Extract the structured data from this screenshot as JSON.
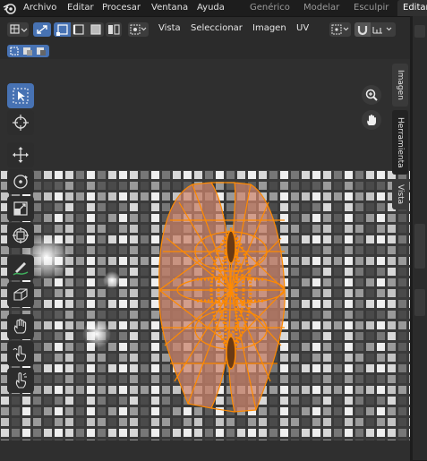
{
  "menu": [
    "Archivo",
    "Editar",
    "Procesar",
    "Ventana",
    "Ayuda"
  ],
  "workspaces": [
    "Genérico",
    "Modelar",
    "Esculpir",
    "Editar"
  ],
  "header_menu": [
    "Vista",
    "Seleccionar",
    "Imagen",
    "UV"
  ],
  "side_tabs": [
    "Imagen",
    "Herramienta",
    "Vista"
  ],
  "tools": [
    "select-box-tool",
    "cursor-tool",
    "move-tool",
    "rotate-tool",
    "scale-tool",
    "transform-tool",
    "annotate-tool",
    "rip-tool",
    "grab-tool",
    "relax-tool",
    "pinch-tool"
  ],
  "colors": {
    "accent": "#4772b3",
    "mesh": "#ff8a00",
    "mesh_fill": "#c9836b"
  }
}
